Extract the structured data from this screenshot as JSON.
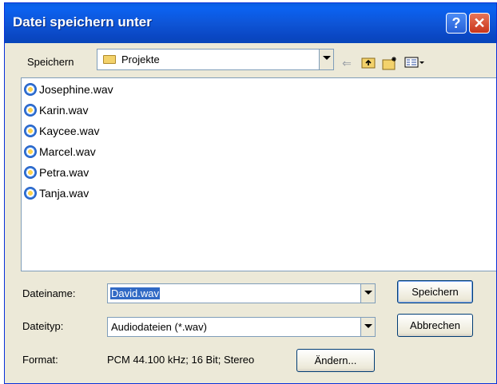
{
  "window": {
    "title": "Datei speichern unter"
  },
  "titlebar": {
    "help_label": "?",
    "close_label": "✕"
  },
  "location": {
    "label": "Speichern",
    "value": "Projekte"
  },
  "toolbar": {
    "back_icon": "back-arrow-icon",
    "up_icon": "folder-up-icon",
    "new_folder_icon": "new-folder-icon",
    "view_icon": "view-menu-icon"
  },
  "files": [
    {
      "name": "Josephine.wav"
    },
    {
      "name": "Karin.wav"
    },
    {
      "name": "Kaycee.wav"
    },
    {
      "name": "Marcel.wav"
    },
    {
      "name": "Petra.wav"
    },
    {
      "name": "Tanja.wav"
    }
  ],
  "filename": {
    "label": "Dateiname:",
    "value": "David.wav"
  },
  "filetype": {
    "label": "Dateityp:",
    "value": "Audiodateien (*.wav)"
  },
  "format": {
    "label": "Format:",
    "value": "PCM 44.100 kHz; 16 Bit; Stereo"
  },
  "buttons": {
    "save": "Speichern",
    "cancel": "Abbrechen",
    "change": "Ändern..."
  },
  "colors": {
    "titlebar": "#0a5fe0",
    "dialog_bg": "#ece9d8",
    "selection": "#316ac5"
  }
}
